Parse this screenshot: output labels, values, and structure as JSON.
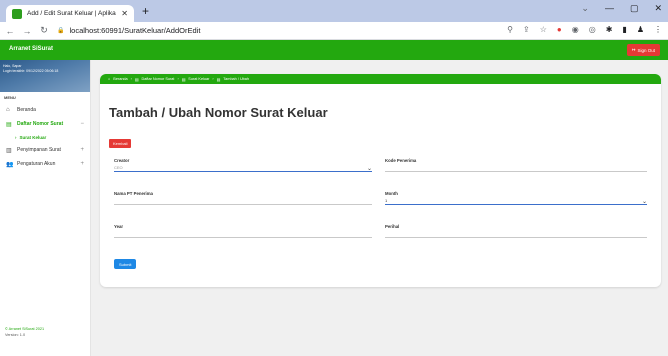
{
  "browser": {
    "tab_title": "Add / Edit Surat Keluar | Aplikasi",
    "tab_close": "✕",
    "new_tab": "+",
    "url": "localhost:60991/SuratKeluar/AddOrEdit",
    "window_controls": [
      "⌄",
      "—",
      "▢",
      "✕"
    ]
  },
  "app": {
    "brand": "Arranet SiSurat",
    "signout_label": "Sign Out"
  },
  "sidebar": {
    "user_line1": "Halo, Sapar",
    "user_line2": "Login terakhir: 09/12/2022 05:06:18",
    "menu_label": "MENU",
    "items": [
      {
        "label": "Beranda",
        "icon": "home-icon"
      },
      {
        "label": "Daftar Nomor Surat",
        "icon": "document-icon",
        "expand": "−",
        "active": true
      },
      {
        "label": "Penyimpanan Surat",
        "icon": "archive-icon",
        "expand": "+"
      },
      {
        "label": "Pengaturan Akun",
        "icon": "users-icon",
        "expand": "+"
      }
    ],
    "sub_item": "Surat Keluar",
    "footer_copyright": "© Arranet SiSurat 2021",
    "footer_version": "Version: 1.0"
  },
  "breadcrumb": [
    "Beranda",
    "Daftar Nomor Surat",
    "Surat Keluar",
    "Tambah / Ubah"
  ],
  "main": {
    "title": "Tambah / Ubah Nomor Surat Keluar",
    "back_label": "Kembali",
    "submit_label": "Submit"
  },
  "form": {
    "creator": {
      "label": "Creator",
      "value": "CEO"
    },
    "kode_penerima": {
      "label": "Kode Penerima",
      "value": ""
    },
    "nama_pt_penerima": {
      "label": "Nama PT Penerima",
      "value": ""
    },
    "month": {
      "label": "Month",
      "value": "1"
    },
    "year": {
      "label": "Year",
      "value": ""
    },
    "perihal": {
      "label": "Perihal",
      "value": ""
    }
  },
  "colors": {
    "brand_green": "#23a80f",
    "danger_red": "#e53935",
    "primary_blue": "#1e88e5"
  }
}
